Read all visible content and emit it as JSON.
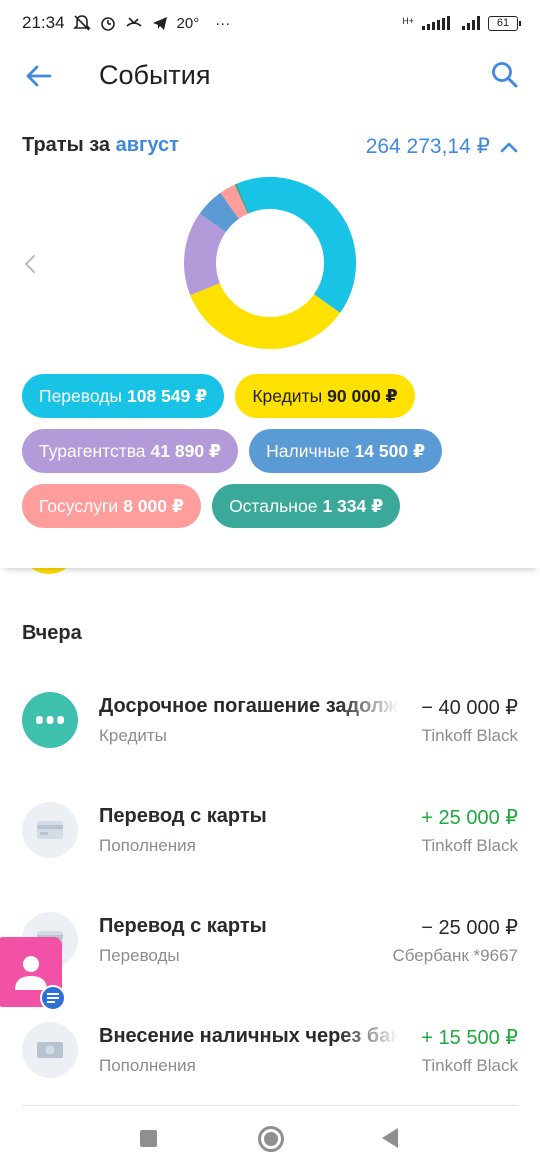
{
  "status_bar": {
    "time": "21:34",
    "temperature": "20°",
    "more": "···",
    "network": "H+",
    "battery": "61"
  },
  "header": {
    "title": "События"
  },
  "summary": {
    "spend_prefix": "Траты за",
    "month": "август",
    "total": "264 273,14 ₽"
  },
  "categories": [
    {
      "label": "Переводы",
      "amount": "108 549 ₽",
      "color": "#19c3e6",
      "value": 108549
    },
    {
      "label": "Кредиты",
      "amount": "90 000 ₽",
      "color": "#ffe100",
      "value": 90000
    },
    {
      "label": "Турагентства",
      "amount": "41 890 ₽",
      "color": "#b39ad8",
      "value": 41890
    },
    {
      "label": "Наличные",
      "amount": "14 500 ₽",
      "color": "#5b9bd5",
      "value": 14500
    },
    {
      "label": "Госуслуги",
      "amount": "8 000 ₽",
      "color": "#ff9c9c",
      "value": 8000
    },
    {
      "label": "Остальное",
      "amount": "1 334 ₽",
      "color": "#3aa99a",
      "value": 1334
    }
  ],
  "day_header": "Вчера",
  "operations": [
    {
      "name": "Досрочное погашение задолженности",
      "category": "Кредиты",
      "amount": "− 40 000 ₽",
      "card": "Tinkoff Black",
      "icon": "dots-icon"
    },
    {
      "name": "Перевод с карты",
      "category": "Пополнения",
      "amount": "+ 25 000 ₽",
      "card": "Tinkoff Black",
      "icon": "card-icon"
    },
    {
      "name": "Перевод с карты",
      "category": "Переводы",
      "amount": "− 25 000 ₽",
      "card": "Сбербанк *9667",
      "icon": "card-icon"
    },
    {
      "name": "Внесение наличных через банкомат",
      "category": "Пополнения",
      "amount": "+ 15 500 ₽",
      "card": "Tinkoff Black",
      "icon": "cash-icon"
    }
  ],
  "colors": {
    "accent": "#3f8ae0",
    "positive": "#1eaa3d",
    "chat": "#f252a6"
  }
}
